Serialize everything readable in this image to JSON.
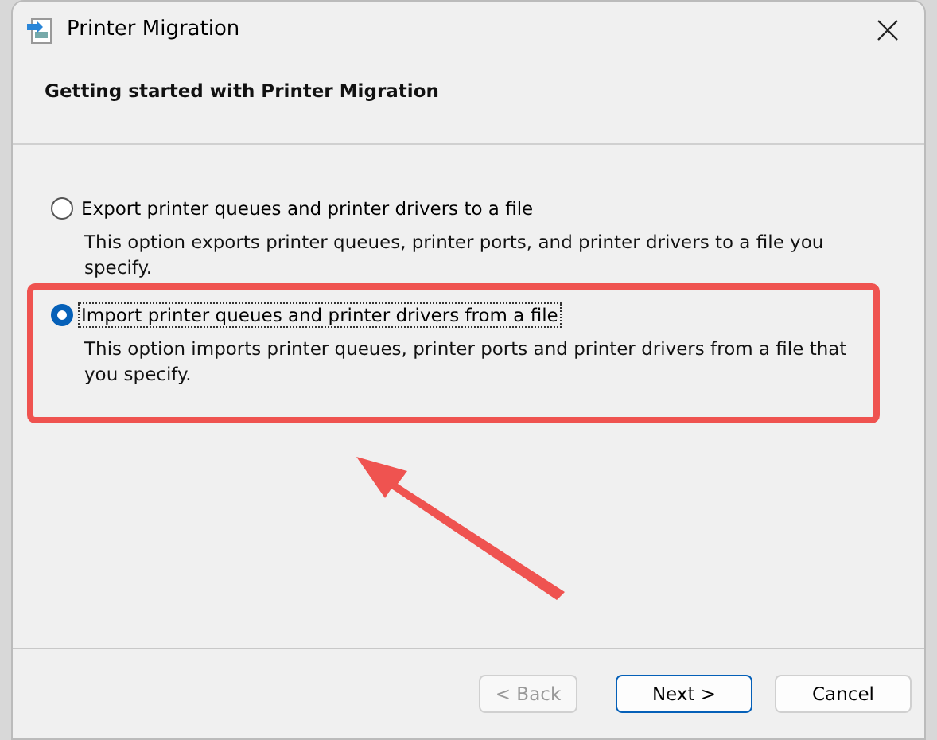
{
  "window": {
    "title": "Printer Migration"
  },
  "header": {
    "title": "Getting started with Printer Migration"
  },
  "options": [
    {
      "label": "Export printer queues and printer drivers to a file",
      "description": "This option exports printer queues, printer ports, and printer drivers to a file you specify.",
      "selected": false
    },
    {
      "label": "Import printer queues and printer drivers from a file",
      "description": "This option imports printer queues, printer ports and printer drivers from a file that you specify.",
      "selected": true
    }
  ],
  "buttons": [
    {
      "label": "< Back",
      "disabled": true,
      "focused": false
    },
    {
      "label": "Next >",
      "disabled": false,
      "focused": true
    },
    {
      "label": "Cancel",
      "disabled": false,
      "focused": false
    }
  ]
}
